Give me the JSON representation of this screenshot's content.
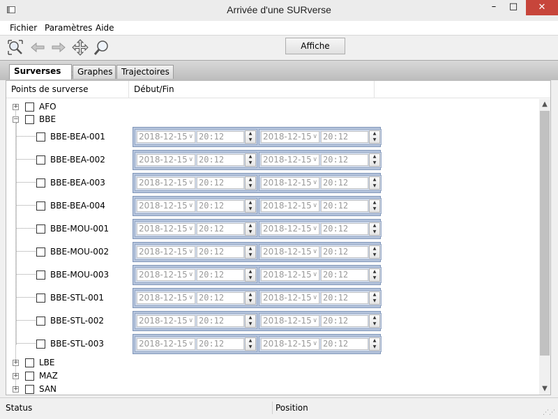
{
  "window": {
    "title": "Arrivée d'une SURverse",
    "minimize_glyph": "–",
    "maximize_glyph": "□",
    "close_glyph": "✕"
  },
  "menu": [
    "Fichier",
    "Paramètres",
    "Aide"
  ],
  "toolbar": {
    "icons": [
      "zoom-fit-icon",
      "arrow-left-icon",
      "arrow-right-icon",
      "move-icon",
      "zoom-icon"
    ],
    "affiche_label": "Affiche"
  },
  "tabs": [
    {
      "label": "Surverses",
      "active": true,
      "close": "✕"
    },
    {
      "label": "Graphes",
      "active": false
    },
    {
      "label": "Trajectoires",
      "active": false
    }
  ],
  "columns": [
    "Points de surverse",
    "Début/Fin"
  ],
  "tree": {
    "groups": [
      {
        "name": "AFO",
        "expanded": false
      },
      {
        "name": "BBE",
        "expanded": true
      },
      {
        "name": "LBE",
        "expanded": false
      },
      {
        "name": "MAZ",
        "expanded": false
      },
      {
        "name": "SAN",
        "expanded": false
      }
    ],
    "bbe_children": [
      {
        "name": "BBE-BEA-001",
        "start_date": "2018-12-15",
        "start_time": "20:12",
        "end_date": "2018-12-15",
        "end_time": "20:12"
      },
      {
        "name": "BBE-BEA-002",
        "start_date": "2018-12-15",
        "start_time": "20:12",
        "end_date": "2018-12-15",
        "end_time": "20:12"
      },
      {
        "name": "BBE-BEA-003",
        "start_date": "2018-12-15",
        "start_time": "20:12",
        "end_date": "2018-12-15",
        "end_time": "20:12"
      },
      {
        "name": "BBE-BEA-004",
        "start_date": "2018-12-15",
        "start_time": "20:12",
        "end_date": "2018-12-15",
        "end_time": "20:12"
      },
      {
        "name": "BBE-MOU-001",
        "start_date": "2018-12-15",
        "start_time": "20:12",
        "end_date": "2018-12-15",
        "end_time": "20:12"
      },
      {
        "name": "BBE-MOU-002",
        "start_date": "2018-12-15",
        "start_time": "20:12",
        "end_date": "2018-12-15",
        "end_time": "20:12"
      },
      {
        "name": "BBE-MOU-003",
        "start_date": "2018-12-15",
        "start_time": "20:12",
        "end_date": "2018-12-15",
        "end_time": "20:12"
      },
      {
        "name": "BBE-STL-001",
        "start_date": "2018-12-15",
        "start_time": "20:12",
        "end_date": "2018-12-15",
        "end_time": "20:12"
      },
      {
        "name": "BBE-STL-002",
        "start_date": "2018-12-15",
        "start_time": "20:12",
        "end_date": "2018-12-15",
        "end_time": "20:12"
      },
      {
        "name": "BBE-STL-003",
        "start_date": "2018-12-15",
        "start_time": "20:12",
        "end_date": "2018-12-15",
        "end_time": "20:12"
      }
    ]
  },
  "status": {
    "left": "Status",
    "right": "Position"
  },
  "colors": {
    "close_button": "#c7453b",
    "datetime_border": "#7f95b8",
    "datetime_fill": "#b7c6de"
  }
}
